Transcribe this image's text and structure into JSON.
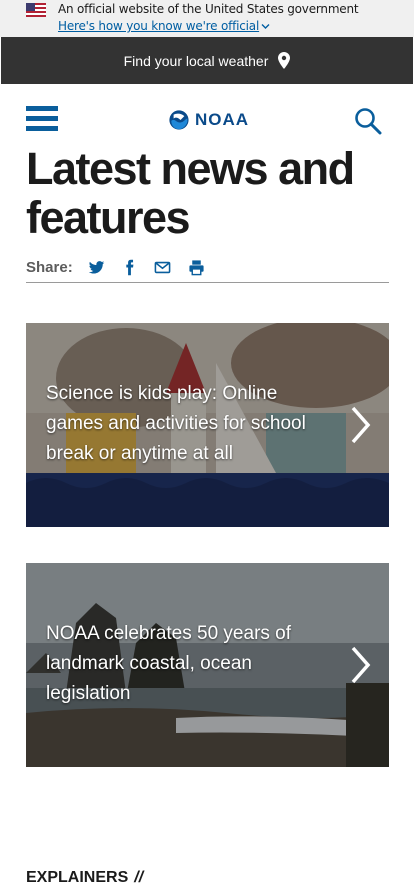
{
  "gov_banner": {
    "official_text": "An official website of the United States government",
    "how_you_know_link": "Here's how you know we're official"
  },
  "weather_bar": {
    "label": "Find your local weather"
  },
  "header": {
    "logo_text": "NOAA",
    "menu_icon": "hamburger-menu-icon",
    "search_icon": "search-icon"
  },
  "page": {
    "title": "Latest news and features"
  },
  "share": {
    "label": "Share:",
    "icons": [
      "twitter-icon",
      "facebook-icon",
      "email-icon",
      "print-icon"
    ]
  },
  "cards": [
    {
      "title": "Science is kids play: Online games and activities for school break or anytime at all"
    },
    {
      "title": "NOAA celebrates 50 years of landmark coastal, ocean legislation"
    }
  ],
  "section": {
    "label": "EXPLAINERS",
    "separator": "//"
  },
  "colors": {
    "primary_blue": "#0a5e9c",
    "dark_bar": "#333333",
    "banner_bg": "#f0f0f0",
    "link_blue": "#005ea2"
  }
}
